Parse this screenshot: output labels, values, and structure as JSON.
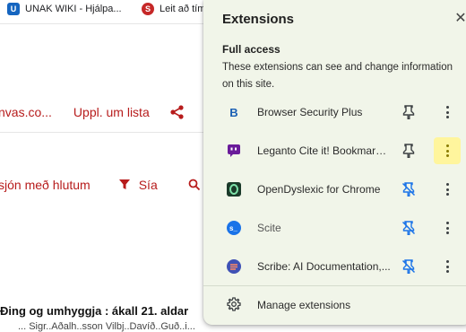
{
  "background": {
    "tabs": [
      {
        "label": "UNAK WIKI - Hjálpa...",
        "icon": "unak-favicon"
      },
      {
        "label": "Leit að tím",
        "icon": "red-s-favicon"
      }
    ],
    "link_truncated": "nvas.co...",
    "action_upload": "Uppl. um lista",
    "filter_truncated": "sjón með hlutum",
    "filter_label": "Sía",
    "result_heading": "Ðing og umhyggja : ákall 21. aldar",
    "result_sub": "... Sigr..Aðalh..sson Vilbj..Davíð..Guð..i..."
  },
  "popup": {
    "title": "Extensions",
    "section_title": "Full access",
    "section_desc": "These extensions can see and change information on this site.",
    "extensions": [
      {
        "name": "Browser Security Plus",
        "icon": "browser-security-plus-icon",
        "pinned": true
      },
      {
        "name": "Leganto Cite it! Bookmarki...",
        "icon": "leganto-cite-icon",
        "pinned": true,
        "menu_highlighted": true
      },
      {
        "name": "OpenDyslexic for Chrome",
        "icon": "opendyslexic-icon",
        "pinned": false
      },
      {
        "name": "Scite",
        "icon": "scite-icon",
        "pinned": false
      },
      {
        "name": "Scribe: AI Documentation,...",
        "icon": "scribe-icon",
        "pinned": false
      }
    ],
    "manage_label": "Manage extensions"
  },
  "colors": {
    "popup_bg": "#f1f5e9",
    "accent_blue": "#1a73e8",
    "accent_red": "#b71c1c",
    "menu_highlight": "#fff59d"
  }
}
